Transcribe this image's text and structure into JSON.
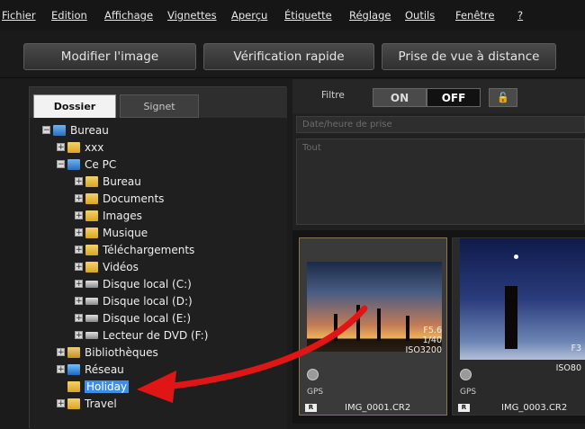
{
  "menubar": {
    "items": [
      "Fichier",
      "Edition",
      "Affichage",
      "Vignettes",
      "Aperçu",
      "Étiquette",
      "Réglage",
      "Outils",
      "Fenêtre",
      "?"
    ]
  },
  "toolbar": {
    "edit_image": "Modifier l'image",
    "quick_check": "Vérification rapide",
    "remote_shooting": "Prise de vue à distance"
  },
  "left_panel": {
    "tabs": [
      "Dossier",
      "Signet"
    ],
    "tree": [
      {
        "label": "Bureau",
        "icon": "computer-icon"
      },
      {
        "label": "xxx",
        "icon": "folder-icon"
      },
      {
        "label": "Ce PC",
        "icon": "computer-icon"
      },
      {
        "label": "Bureau",
        "icon": "folder-icon"
      },
      {
        "label": "Documents",
        "icon": "folder-icon"
      },
      {
        "label": "Images",
        "icon": "folder-icon"
      },
      {
        "label": "Musique",
        "icon": "folder-icon"
      },
      {
        "label": "Téléchargements",
        "icon": "folder-icon"
      },
      {
        "label": "Vidéos",
        "icon": "folder-icon"
      },
      {
        "label": "Disque local (C:)",
        "icon": "drive-icon"
      },
      {
        "label": "Disque local (D:)",
        "icon": "drive-icon"
      },
      {
        "label": "Disque local (E:)",
        "icon": "drive-icon"
      },
      {
        "label": "Lecteur de DVD (F:)",
        "icon": "dvd-icon"
      },
      {
        "label": "Bibliothèques",
        "icon": "library-icon"
      },
      {
        "label": "Réseau",
        "icon": "network-icon"
      },
      {
        "label": "Holiday",
        "icon": "folder-icon"
      },
      {
        "label": "Travel",
        "icon": "folder-icon"
      }
    ]
  },
  "filter": {
    "label": "Filtre",
    "on": "ON",
    "off": "OFF",
    "date_placeholder": "Date/heure de prise",
    "all_label": "Tout"
  },
  "thumbnails": [
    {
      "filename": "IMG_0001.CR2",
      "aperture": "F5.6",
      "shutter": "1/40",
      "iso": "ISO3200",
      "gps": "GPS",
      "badge": "R"
    },
    {
      "filename": "IMG_0003.CR2",
      "aperture": "F3",
      "shutter": "",
      "iso": "ISO80",
      "gps": "GPS",
      "badge": "R"
    }
  ],
  "colors": {
    "selection": "#3d8ee8",
    "arrow": "#e01616",
    "background": "#1b1b1b"
  }
}
